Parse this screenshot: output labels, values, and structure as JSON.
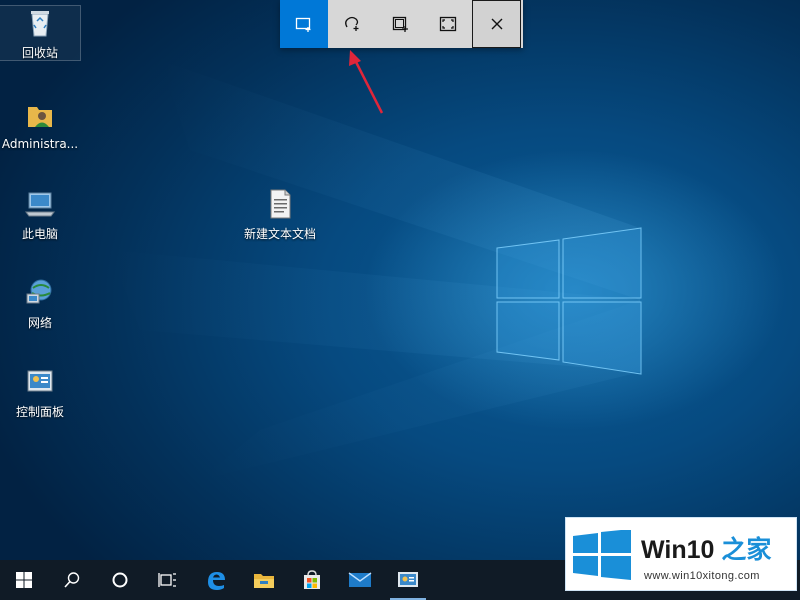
{
  "desktop": {
    "icons": [
      {
        "label": "回收站",
        "icon": "recycle-bin-icon"
      },
      {
        "label": "Administra...",
        "icon": "user-folder-icon"
      },
      {
        "label": "此电脑",
        "icon": "this-pc-icon"
      },
      {
        "label": "网络",
        "icon": "network-icon"
      },
      {
        "label": "控制面板",
        "icon": "control-panel-icon"
      },
      {
        "label": "新建文本文档",
        "icon": "text-document-icon"
      }
    ]
  },
  "snip_toolbar": {
    "buttons": [
      {
        "name": "rectangular-snip",
        "icon": "rectangle-snip-icon",
        "active": true
      },
      {
        "name": "freeform-snip",
        "icon": "freeform-snip-icon",
        "active": false
      },
      {
        "name": "window-snip",
        "icon": "window-snip-icon",
        "active": false
      },
      {
        "name": "fullscreen-snip",
        "icon": "fullscreen-snip-icon",
        "active": false
      },
      {
        "name": "close",
        "icon": "close-icon",
        "active": false
      }
    ],
    "active_color": "#0078d7"
  },
  "annotation": {
    "arrow_color": "#e0263a"
  },
  "taskbar": {
    "items": [
      {
        "icon": "windows-start-icon"
      },
      {
        "icon": "search-icon"
      },
      {
        "icon": "cortana-icon"
      },
      {
        "icon": "task-view-icon"
      },
      {
        "icon": "edge-icon"
      },
      {
        "icon": "file-explorer-icon"
      },
      {
        "icon": "store-icon"
      },
      {
        "icon": "mail-icon"
      },
      {
        "icon": "control-panel-icon",
        "running": true
      }
    ]
  },
  "watermark": {
    "title_part1": "Win10 ",
    "title_part2": "之家",
    "url": "www.win10xitong.com"
  },
  "colors": {
    "taskbar": "#101b26",
    "accent": "#0078d7",
    "watermark_accent": "#1a8fd8"
  }
}
